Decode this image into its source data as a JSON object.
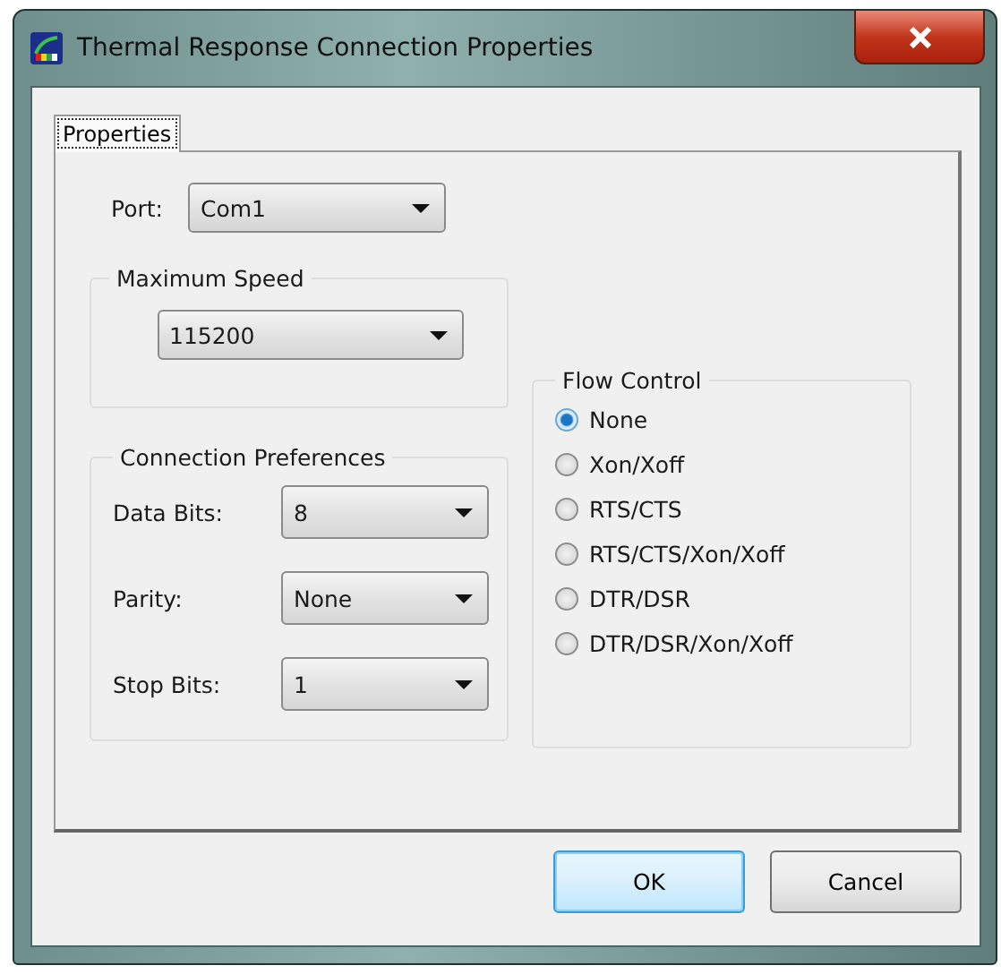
{
  "window": {
    "title": "Thermal Response Connection Properties"
  },
  "tabs": [
    {
      "label": "Properties",
      "selected": true
    }
  ],
  "port": {
    "label": "Port:",
    "value": "Com1"
  },
  "max_speed": {
    "title": "Maximum Speed",
    "value": "115200"
  },
  "connection_preferences": {
    "title": "Connection Preferences",
    "fields": [
      {
        "label": "Data Bits:",
        "value": "8"
      },
      {
        "label": "Parity:",
        "value": "None"
      },
      {
        "label": "Stop Bits:",
        "value": "1"
      }
    ]
  },
  "flow_control": {
    "title": "Flow Control",
    "options": [
      {
        "label": "None",
        "selected": true
      },
      {
        "label": "Xon/Xoff",
        "selected": false
      },
      {
        "label": "RTS/CTS",
        "selected": false
      },
      {
        "label": "RTS/CTS/Xon/Xoff",
        "selected": false
      },
      {
        "label": "DTR/DSR",
        "selected": false
      },
      {
        "label": "DTR/DSR/Xon/Xoff",
        "selected": false
      }
    ]
  },
  "buttons": [
    {
      "label": "OK",
      "default": true
    },
    {
      "label": "Cancel",
      "default": false
    }
  ]
}
